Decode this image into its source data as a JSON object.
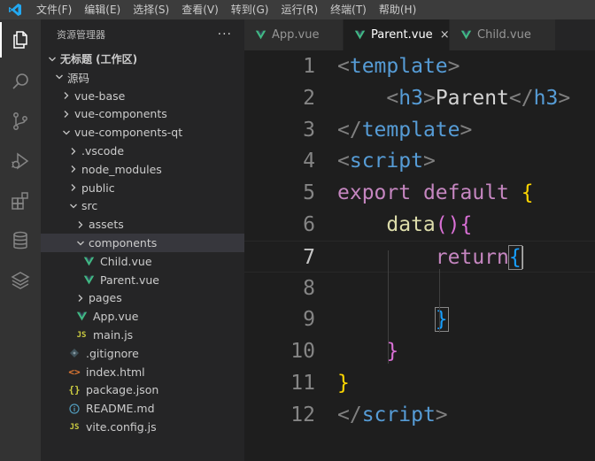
{
  "menu": [
    "文件(F)",
    "编辑(E)",
    "选择(S)",
    "查看(V)",
    "转到(G)",
    "运行(R)",
    "终端(T)",
    "帮助(H)"
  ],
  "activity": [
    "explorer-icon",
    "search-icon",
    "source-control-icon",
    "run-debug-icon",
    "extensions-icon",
    "database-icon",
    "layers-icon"
  ],
  "sidebar": {
    "title": "资源管理器",
    "more": "···",
    "tree": [
      {
        "label": "无标题 (工作区)",
        "type": "folder-open",
        "depth": 0,
        "bold": true
      },
      {
        "label": "源码",
        "type": "folder-open",
        "depth": 1
      },
      {
        "label": "vue-base",
        "type": "folder",
        "depth": 2
      },
      {
        "label": "vue-components",
        "type": "folder",
        "depth": 2
      },
      {
        "label": "vue-components-qt",
        "type": "folder-open",
        "depth": 2
      },
      {
        "label": ".vscode",
        "type": "folder",
        "depth": 3
      },
      {
        "label": "node_modules",
        "type": "folder",
        "depth": 3
      },
      {
        "label": "public",
        "type": "folder",
        "depth": 3
      },
      {
        "label": "src",
        "type": "folder-open",
        "depth": 3
      },
      {
        "label": "assets",
        "type": "folder",
        "depth": 4
      },
      {
        "label": "components",
        "type": "folder-open",
        "depth": 4,
        "selected": true
      },
      {
        "label": "Child.vue",
        "type": "vue",
        "depth": 5
      },
      {
        "label": "Parent.vue",
        "type": "vue",
        "depth": 5
      },
      {
        "label": "pages",
        "type": "folder",
        "depth": 4
      },
      {
        "label": "App.vue",
        "type": "vue",
        "depth": 4
      },
      {
        "label": "main.js",
        "type": "js",
        "depth": 4
      },
      {
        "label": ".gitignore",
        "type": "git",
        "depth": 3
      },
      {
        "label": "index.html",
        "type": "html",
        "depth": 3
      },
      {
        "label": "package.json",
        "type": "json",
        "depth": 3
      },
      {
        "label": "README.md",
        "type": "info",
        "depth": 3
      },
      {
        "label": "vite.config.js",
        "type": "js",
        "depth": 3
      }
    ]
  },
  "tabs": [
    {
      "label": "App.vue",
      "active": false
    },
    {
      "label": "Parent.vue",
      "active": true,
      "close": "×"
    },
    {
      "label": "Child.vue",
      "active": false
    }
  ],
  "editor": {
    "current_line": 7,
    "lines": [
      {
        "n": "1",
        "tokens": [
          [
            "<",
            "punc"
          ],
          [
            "template",
            "tag"
          ],
          [
            ">",
            "punc"
          ]
        ]
      },
      {
        "n": "2",
        "tokens": [
          [
            "    ",
            "text"
          ],
          [
            "<",
            "punc"
          ],
          [
            "h3",
            "tag"
          ],
          [
            ">",
            "punc"
          ],
          [
            "Parent",
            "text"
          ],
          [
            "</",
            "punc"
          ],
          [
            "h3",
            "tag"
          ],
          [
            ">",
            "punc"
          ]
        ]
      },
      {
        "n": "3",
        "tokens": [
          [
            "</",
            "punc"
          ],
          [
            "template",
            "tag"
          ],
          [
            ">",
            "punc"
          ]
        ]
      },
      {
        "n": "4",
        "tokens": [
          [
            "<",
            "punc"
          ],
          [
            "script",
            "tag"
          ],
          [
            ">",
            "punc"
          ]
        ]
      },
      {
        "n": "5",
        "tokens": [
          [
            "export",
            "kw"
          ],
          [
            " ",
            "text"
          ],
          [
            "default",
            "kw"
          ],
          [
            " ",
            "text"
          ],
          [
            "{",
            "b1"
          ]
        ]
      },
      {
        "n": "6",
        "tokens": [
          [
            "    ",
            "text"
          ],
          [
            "data",
            "fn"
          ],
          [
            "()",
            "b2"
          ],
          [
            "{",
            "b2"
          ]
        ]
      },
      {
        "n": "7",
        "tokens": [
          [
            "        ",
            "text"
          ],
          [
            "return",
            "kw"
          ],
          [
            "{",
            "b3",
            "match"
          ],
          [
            "",
            "cursor"
          ]
        ]
      },
      {
        "n": "8",
        "tokens": []
      },
      {
        "n": "9",
        "tokens": [
          [
            "        ",
            "text"
          ],
          [
            "}",
            "b3",
            "match"
          ]
        ]
      },
      {
        "n": "10",
        "tokens": [
          [
            "    ",
            "text"
          ],
          [
            "}",
            "b2"
          ]
        ]
      },
      {
        "n": "11",
        "tokens": [
          [
            "}",
            "b1"
          ]
        ]
      },
      {
        "n": "12",
        "tokens": [
          [
            "</",
            "punc"
          ],
          [
            "script",
            "tag"
          ],
          [
            ">",
            "punc"
          ]
        ]
      }
    ]
  },
  "colors": {
    "vue_green": "#41b883",
    "vue_dark": "#35495e",
    "js_yellow": "#cbcb41",
    "vscode_blue": "#007acc"
  }
}
